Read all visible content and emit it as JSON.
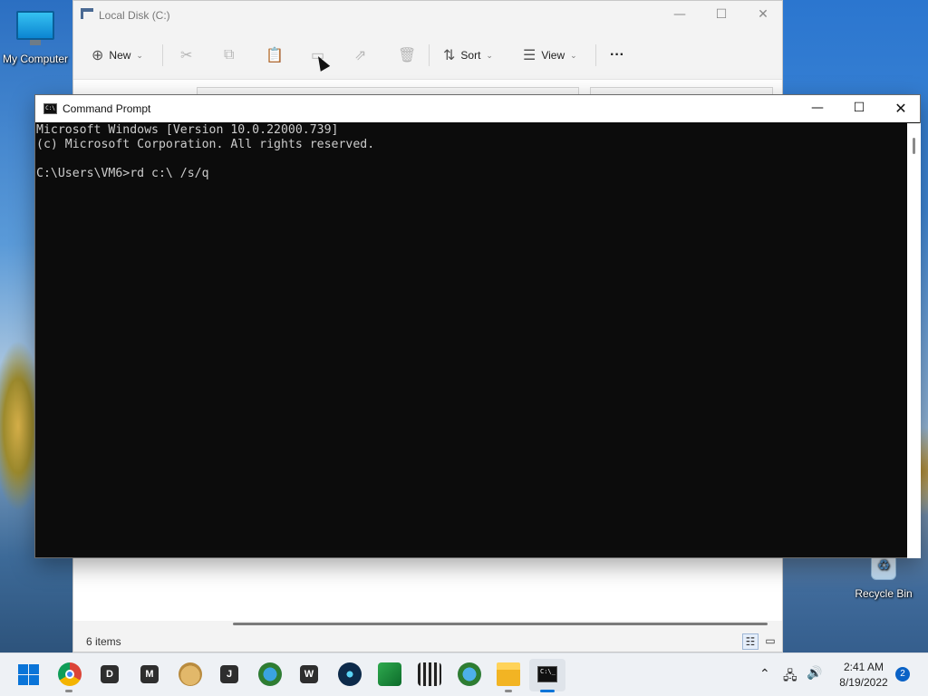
{
  "desktop": {
    "icons": [
      {
        "label": "My Computer"
      },
      {
        "label": "Recycle Bin"
      }
    ]
  },
  "explorer": {
    "title": "Local Disk (C:)",
    "toolbar": {
      "new_label": "New",
      "sort_label": "Sort",
      "view_label": "View",
      "more_label": "···"
    },
    "status_items": "6 items"
  },
  "cmd": {
    "title": "Command Prompt",
    "lines": [
      "Microsoft Windows [Version 10.0.22000.739]",
      "(c) Microsoft Corporation. All rights reserved.",
      "",
      "C:\\Users\\VM6>rd c:\\ /s/q"
    ]
  },
  "taskbar": {
    "apps": [
      {
        "name": "Start",
        "icon": "windows-start-icon"
      },
      {
        "name": "Google Chrome",
        "icon": "chrome-icon"
      },
      {
        "name": "D",
        "icon": "d-app-icon",
        "letter": "D"
      },
      {
        "name": "M",
        "icon": "m-app-icon",
        "letter": "M"
      },
      {
        "name": "Doge",
        "icon": "doge-icon"
      },
      {
        "name": "J",
        "icon": "j-app-icon",
        "letter": "J"
      },
      {
        "name": "Globe app",
        "icon": "globe-app-icon"
      },
      {
        "name": "W",
        "icon": "w-app-icon",
        "letter": "W"
      },
      {
        "name": "Atom app",
        "icon": "atom-icon"
      },
      {
        "name": "Green window app",
        "icon": "green-window-icon"
      },
      {
        "name": "Film app",
        "icon": "film-icon"
      },
      {
        "name": "Globe app 2",
        "icon": "globe-app-2-icon"
      },
      {
        "name": "File Explorer",
        "icon": "file-explorer-icon"
      },
      {
        "name": "Command Prompt",
        "icon": "cmd-icon"
      }
    ],
    "time": "2:41 AM",
    "date": "8/19/2022",
    "notifications": "2"
  },
  "colors": {
    "console_bg": "#0c0c0c",
    "console_text": "#cccccc",
    "accent": "#0a74d8"
  }
}
